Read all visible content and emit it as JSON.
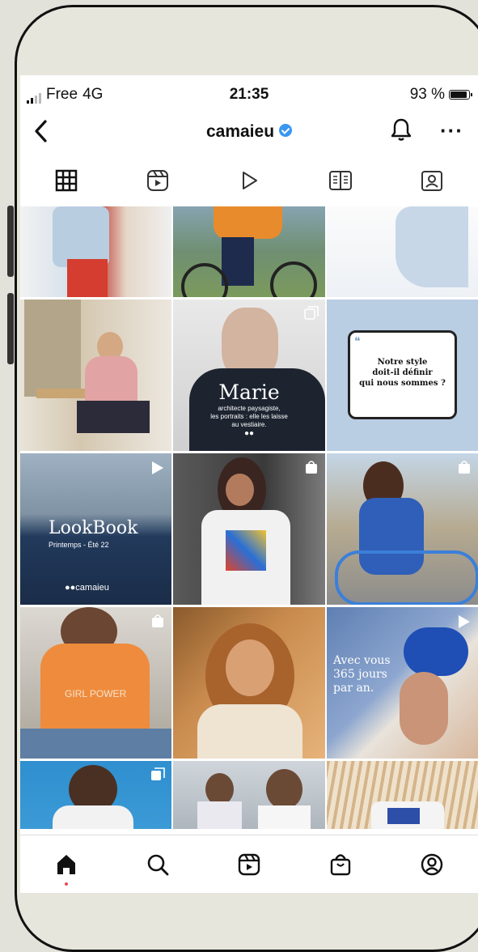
{
  "status": {
    "carrier": "Free",
    "network": "4G",
    "time": "21:35",
    "battery": "93 %",
    "battery_level": 0.93
  },
  "header": {
    "username": "camaieu",
    "verified": true
  },
  "tabs": [
    {
      "icon": "grid-icon",
      "active": true
    },
    {
      "icon": "reels-icon",
      "active": false
    },
    {
      "icon": "video-play-icon",
      "active": false
    },
    {
      "icon": "guide-book-icon",
      "active": false
    },
    {
      "icon": "tagged-user-icon",
      "active": false
    }
  ],
  "posts": {
    "marie": {
      "title": "Marie",
      "caption_1": "architecte paysagiste,",
      "caption_2": "les portraits : elle les laisse",
      "caption_3": "au vestiaire."
    },
    "quote": {
      "text_1": "Notre style",
      "text_2": "doit-il définir",
      "text_3": "qui nous sommes ?"
    },
    "lookbook": {
      "title": "LookBook",
      "subtitle": "Printemps - Été 22",
      "brand": "●●camaieu"
    },
    "tshirt": {
      "print": "GIRL POWER"
    },
    "avec": {
      "line_1": "Avec vous",
      "line_2": "365 jours",
      "line_3": "par an."
    }
  },
  "bottom_nav": [
    {
      "icon": "home-icon",
      "active": true
    },
    {
      "icon": "search-icon",
      "active": false
    },
    {
      "icon": "reels-icon",
      "active": false
    },
    {
      "icon": "shop-bag-icon",
      "active": false
    },
    {
      "icon": "profile-icon",
      "active": false
    }
  ],
  "colors": {
    "accent_blue": "#3897f0",
    "notification_dot": "#ed4956"
  }
}
